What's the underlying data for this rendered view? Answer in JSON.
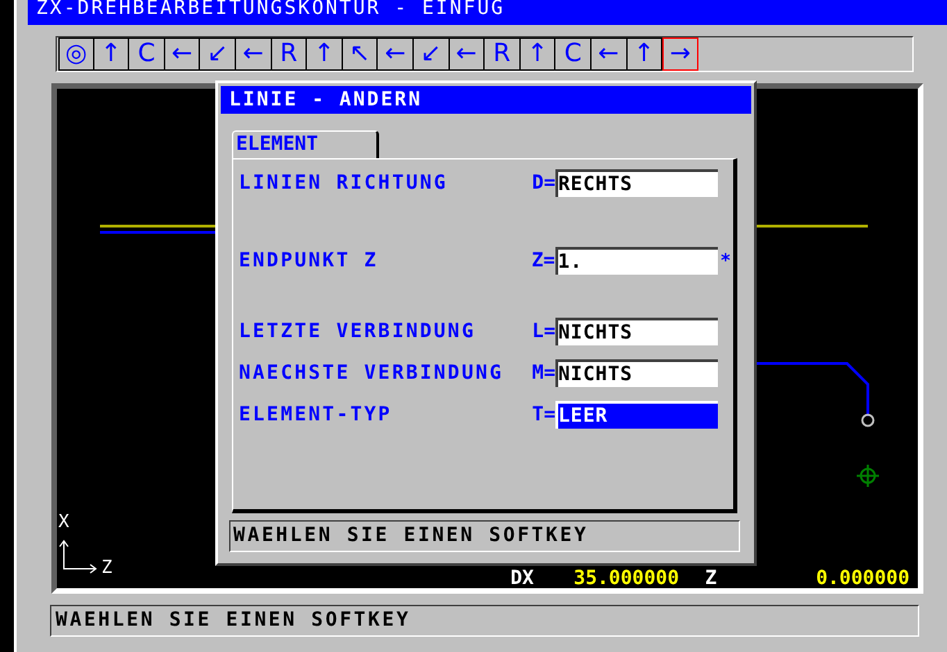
{
  "window": {
    "title": "ZX-DREHBEARBEITUNGSKONTUR - EINFUG"
  },
  "toolbar": [
    {
      "symbol": "◎",
      "selected": false
    },
    {
      "symbol": "↑",
      "selected": false
    },
    {
      "symbol": "C",
      "selected": false
    },
    {
      "symbol": "←",
      "selected": false
    },
    {
      "symbol": "↙",
      "selected": false
    },
    {
      "symbol": "←",
      "selected": false
    },
    {
      "symbol": "R",
      "selected": false
    },
    {
      "symbol": "↑",
      "selected": false
    },
    {
      "symbol": "↖",
      "selected": false
    },
    {
      "symbol": "←",
      "selected": false
    },
    {
      "symbol": "↙",
      "selected": false
    },
    {
      "symbol": "←",
      "selected": false
    },
    {
      "symbol": "R",
      "selected": false
    },
    {
      "symbol": "↑",
      "selected": false
    },
    {
      "symbol": "C",
      "selected": false
    },
    {
      "symbol": "←",
      "selected": false
    },
    {
      "symbol": "↑",
      "selected": false
    },
    {
      "symbol": "→",
      "selected": true
    }
  ],
  "canvas": {
    "axis_x": "X",
    "axis_z": "Z",
    "readouts": [
      {
        "label": "DX",
        "value": "35.000000"
      },
      {
        "label": "Z",
        "value": "0.000000"
      }
    ]
  },
  "dialog": {
    "title": "LINIE - ANDERN",
    "tab": "ELEMENT",
    "fields": [
      {
        "label": "LINIEN RICHTUNG",
        "key": "D=",
        "value": "RECHTS",
        "selected": false
      },
      {
        "label": "ENDPUNKT Z",
        "key": "Z=",
        "value": "1.",
        "selected": false,
        "marker": "*"
      },
      {
        "label": "LETZTE VERBINDUNG",
        "key": "L=",
        "value": "NICHTS",
        "selected": false
      },
      {
        "label": "NAECHSTE VERBINDUNG",
        "key": "M=",
        "value": "NICHTS",
        "selected": false
      },
      {
        "label": "ELEMENT-TYP",
        "key": "T=",
        "value": "LEER",
        "selected": true
      }
    ],
    "message": "WAEHLEN SIE EINEN SOFTKEY"
  },
  "status_bar": "WAEHLEN SIE EINEN SOFTKEY"
}
